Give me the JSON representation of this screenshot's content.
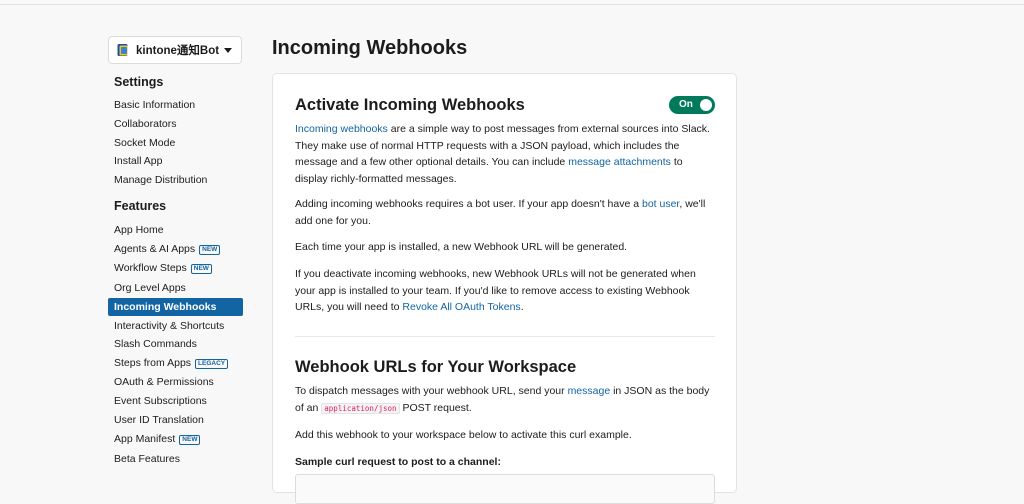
{
  "app_selector": {
    "name": "kintone通知Bot"
  },
  "sidebar": {
    "settings_heading": "Settings",
    "settings_items": [
      {
        "label": "Basic Information"
      },
      {
        "label": "Collaborators"
      },
      {
        "label": "Socket Mode"
      },
      {
        "label": "Install App"
      },
      {
        "label": "Manage Distribution"
      }
    ],
    "features_heading": "Features",
    "features_items": [
      {
        "label": "App Home",
        "badge": ""
      },
      {
        "label": "Agents & AI Apps",
        "badge": "NEW"
      },
      {
        "label": "Workflow Steps",
        "badge": "NEW"
      },
      {
        "label": "Org Level Apps",
        "badge": ""
      },
      {
        "label": "Incoming Webhooks",
        "badge": "",
        "active": true
      },
      {
        "label": "Interactivity & Shortcuts",
        "badge": ""
      },
      {
        "label": "Slash Commands",
        "badge": ""
      },
      {
        "label": "Steps from Apps",
        "badge": "LEGACY"
      },
      {
        "label": "OAuth & Permissions",
        "badge": ""
      },
      {
        "label": "Event Subscriptions",
        "badge": ""
      },
      {
        "label": "User ID Translation",
        "badge": ""
      },
      {
        "label": "App Manifest",
        "badge": "NEW"
      },
      {
        "label": "Beta Features",
        "badge": ""
      }
    ]
  },
  "page": {
    "title": "Incoming Webhooks",
    "activate": {
      "heading": "Activate Incoming Webhooks",
      "toggle_label": "On",
      "toggle_state": "on",
      "p1": {
        "link1": "Incoming webhooks",
        "text1": " are a simple way to post messages from external sources into Slack. They make use of normal HTTP requests with a JSON payload, which includes the message and a few other optional details. You can include ",
        "link2": "message attachments",
        "text2": " to display richly-formatted messages."
      },
      "p2": {
        "text1": "Adding incoming webhooks requires a bot user. If your app doesn't have a ",
        "link": "bot user",
        "text2": ", we'll add one for you."
      },
      "p3": "Each time your app is installed, a new Webhook URL will be generated.",
      "p4": {
        "text1": "If you deactivate incoming webhooks, new Webhook URLs will not be generated when your app is installed to your team. If you'd like to remove access to existing Webhook URLs, you will need to ",
        "link": "Revoke All OAuth Tokens",
        "text2": "."
      }
    },
    "workspace": {
      "heading": "Webhook URLs for Your Workspace",
      "p1": {
        "text1": "To dispatch messages with your webhook URL, send your ",
        "link": "message",
        "text2": " in JSON as the body of an ",
        "code": "application/json",
        "text3": " POST request."
      },
      "p2": "Add this webhook to your workspace below to activate this curl example.",
      "sample_label": "Sample curl request to post to a channel:"
    }
  },
  "colors": {
    "accent": "#1264a3",
    "toggle_on": "#007a5a",
    "code_text": "#e01e5a"
  }
}
